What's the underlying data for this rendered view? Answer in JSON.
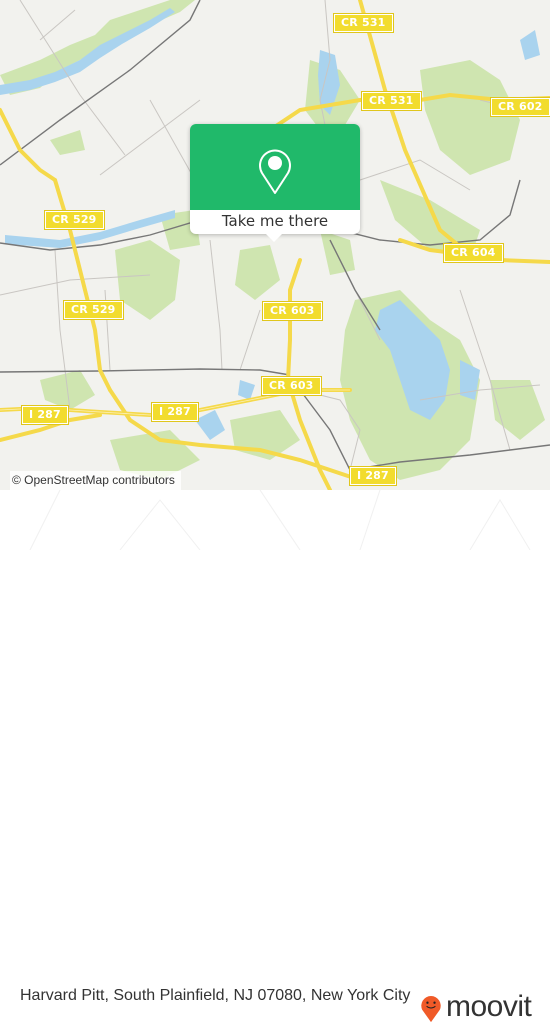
{
  "map": {
    "road_labels": [
      {
        "id": "cr531-top",
        "text": "CR 531"
      },
      {
        "id": "cr531-mid",
        "text": "CR 531"
      },
      {
        "id": "cr602",
        "text": "CR 602"
      },
      {
        "id": "cr529-top",
        "text": "CR 529"
      },
      {
        "id": "cr529-bottom",
        "text": "CR 529"
      },
      {
        "id": "cr604",
        "text": "CR 604"
      },
      {
        "id": "cr603-top",
        "text": "CR 603"
      },
      {
        "id": "cr603-bottom",
        "text": "CR 603"
      },
      {
        "id": "i287-left",
        "text": "I 287"
      },
      {
        "id": "i287-mid",
        "text": "I 287"
      },
      {
        "id": "i287-right",
        "text": "I 287"
      }
    ],
    "attribution": "© OpenStreetMap contributors",
    "colors": {
      "background": "#f2f2ee",
      "park": "#cfe5b0",
      "water": "#a9d3ee",
      "road": "#f5d94a",
      "rail": "#777777",
      "accent": "#20b96a"
    }
  },
  "popup": {
    "icon": "map-pin-icon",
    "button_label": "Take me there"
  },
  "footer": {
    "address": "Harvard Pitt, South Plainfield, NJ 07080, New York City",
    "brand": "moovit",
    "brand_color": "#f05a28"
  }
}
